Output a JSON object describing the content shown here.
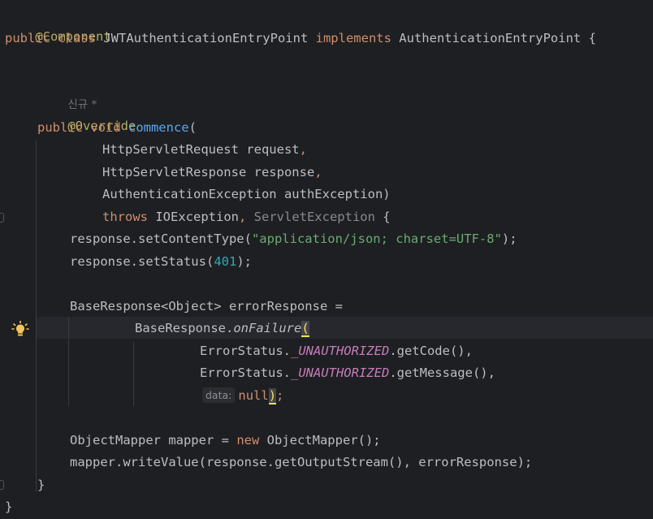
{
  "code": {
    "l1": {
      "ann": "@Component"
    },
    "l2": {
      "kw1": "public class ",
      "cls": "JWTAuthenticationEntryPoint ",
      "kw2": "implements ",
      "iface": "AuthenticationEntryPoint {"
    },
    "l3": {
      "usage": "신규 *"
    },
    "l4": {
      "ann": "@Override"
    },
    "l5": {
      "kw": "public void ",
      "fn": "commence",
      "rest": "("
    },
    "l6": {
      "text": "HttpServletRequest request",
      "comma": ","
    },
    "l7": {
      "text": "HttpServletResponse response",
      "comma": ","
    },
    "l8": {
      "text": "AuthenticationException authException)"
    },
    "l9": {
      "kw": "throws ",
      "ex1": "IOException",
      "comma": ", ",
      "ex2": "ServletException",
      "rest": " {"
    },
    "l10": {
      "pre": "response.setContentType(",
      "str": "\"application/json; charset=UTF-8\"",
      "post": ");"
    },
    "l11": {
      "pre": "response.setStatus(",
      "num": "401",
      "post": ");"
    },
    "l12": {
      "text": "BaseResponse<Object> errorResponse ="
    },
    "l13": {
      "pre": "BaseResponse.",
      "call": "onFailure",
      "paren": "("
    },
    "l14": {
      "pre": "ErrorStatus.",
      "const": "_UNAUTHORIZED",
      "post": ".getCode(),"
    },
    "l15": {
      "pre": "ErrorStatus.",
      "const": "_UNAUTHORIZED",
      "post": ".getMessage(),"
    },
    "l16": {
      "hint": "data:",
      "kw": "null",
      "paren": ")",
      "semi": ";"
    },
    "l17": {
      "pre": "ObjectMapper mapper = ",
      "kw": "new ",
      "post": "ObjectMapper();"
    },
    "l18": {
      "pre": "mapper.writeValue(response.getOutputStream(), errorResponse);"
    },
    "l19": {
      "text": "}"
    },
    "l20": {
      "text": "}"
    }
  },
  "colors": {
    "background": "#1e1f22",
    "keyword": "#cf8e6d",
    "annotation": "#b3ae60",
    "string": "#6aab73",
    "number": "#2aacb8",
    "static_field": "#c77dbb",
    "method_decl": "#56a8f5"
  },
  "icons": {
    "intention": "lightbulb-icon"
  }
}
